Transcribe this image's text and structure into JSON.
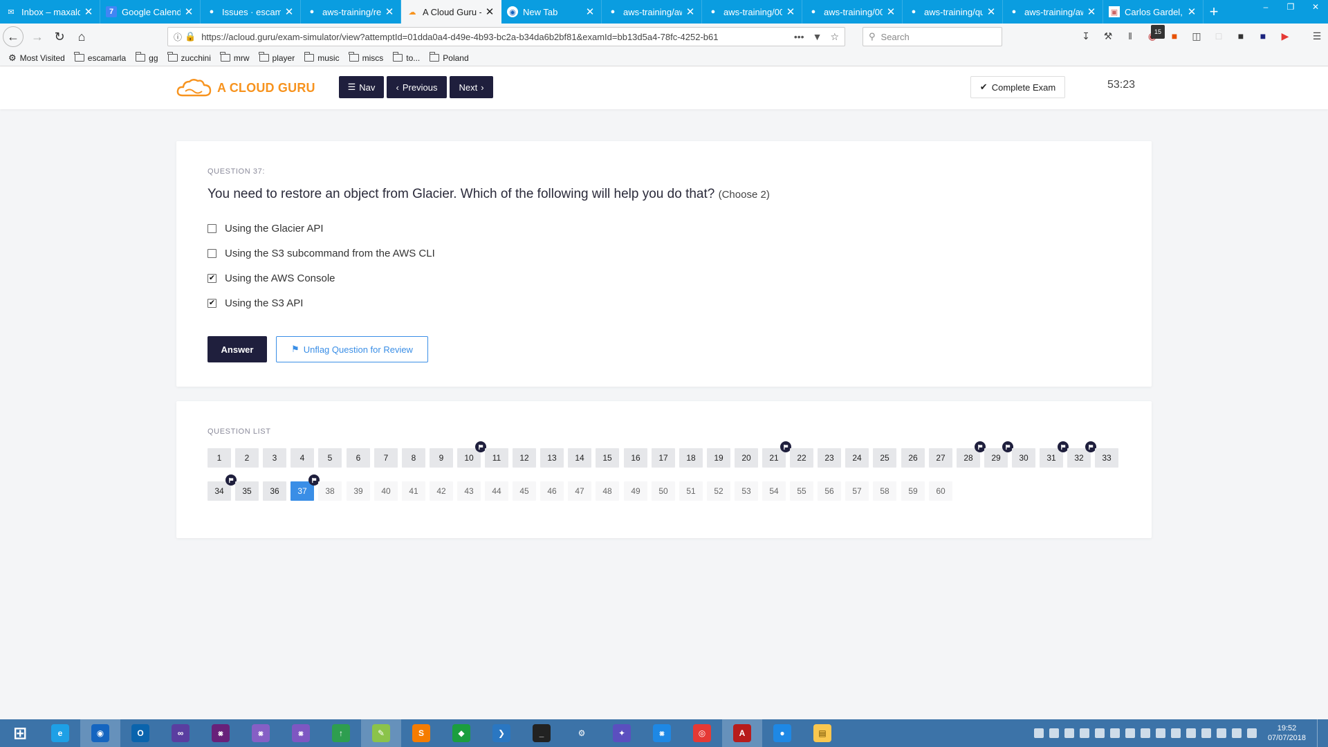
{
  "browser": {
    "tabs": [
      {
        "label": "Inbox – maxaldo",
        "icon": "mail-icon",
        "color": "#ffffff"
      },
      {
        "label": "Google Calendar",
        "icon": "calendar-icon",
        "color": "#ffffff"
      },
      {
        "label": "Issues · escamarla",
        "icon": "github-icon",
        "color": "#ffffff"
      },
      {
        "label": "aws-training/re",
        "icon": "github-icon",
        "color": "#ffffff"
      },
      {
        "label": "A Cloud Guru - ",
        "icon": "cloud-icon",
        "color": "#f7931e",
        "active": true
      },
      {
        "label": "New Tab",
        "icon": "firefox-icon",
        "color": "#ffffff"
      },
      {
        "label": "aws-training/aw",
        "icon": "github-icon",
        "color": "#ffffff"
      },
      {
        "label": "aws-training/00",
        "icon": "github-icon",
        "color": "#ffffff"
      },
      {
        "label": "aws-training/00",
        "icon": "github-icon",
        "color": "#ffffff"
      },
      {
        "label": "aws-training/qu",
        "icon": "github-icon",
        "color": "#ffffff"
      },
      {
        "label": "aws-training/aw",
        "icon": "github-icon",
        "color": "#ffffff"
      },
      {
        "label": "Carlos Gardel, Y",
        "icon": "page-icon",
        "color": "#ffffff"
      }
    ],
    "url": "https://acloud.guru/exam-simulator/view?attemptId=01dda0a4-d49e-4b93-bc2a-b34da6b2bf81&examId=bb13d5a4-78fc-4252-b61",
    "search_placeholder": "Search",
    "bookmarks": [
      {
        "label": "Most Visited",
        "type": "gear"
      },
      {
        "label": "escamarla",
        "type": "folder"
      },
      {
        "label": "gg",
        "type": "folder"
      },
      {
        "label": "zucchini",
        "type": "folder"
      },
      {
        "label": "mrw",
        "type": "folder"
      },
      {
        "label": "player",
        "type": "folder"
      },
      {
        "label": "music",
        "type": "folder"
      },
      {
        "label": "miscs",
        "type": "folder"
      },
      {
        "label": "to...",
        "type": "folder"
      },
      {
        "label": "Poland",
        "type": "folder"
      }
    ],
    "notification_badge": "15"
  },
  "header": {
    "logo_text": "A CLOUD GURU",
    "nav_label": "Nav",
    "previous_label": "Previous",
    "next_label": "Next",
    "complete_label": "Complete Exam",
    "timer": "53:23",
    "brand_color": "#f7931e",
    "dark_color": "#1f1f3d"
  },
  "question": {
    "eyebrow": "QUESTION 37:",
    "text": "You need to restore an object from Glacier. Which of the following will help you do that?",
    "choose": "(Choose 2)",
    "options": [
      {
        "label": "Using the Glacier API",
        "checked": false
      },
      {
        "label": "Using the S3 subcommand from the AWS CLI",
        "checked": false
      },
      {
        "label": "Using the AWS Console",
        "checked": true
      },
      {
        "label": "Using the S3 API",
        "checked": true
      }
    ],
    "answer_label": "Answer",
    "unflag_label": "Unflag Question for Review"
  },
  "question_list": {
    "title": "QUESTION LIST",
    "current": 37,
    "answered_through": 36,
    "flagged": [
      10,
      21,
      28,
      29,
      31,
      32,
      34,
      37
    ],
    "items": [
      "1",
      "2",
      "3",
      "4",
      "5",
      "6",
      "7",
      "8",
      "9",
      "10",
      "11",
      "12",
      "13",
      "14",
      "15",
      "16",
      "17",
      "18",
      "19",
      "20",
      "21",
      "22",
      "23",
      "24",
      "25",
      "26",
      "27",
      "28",
      "29",
      "30",
      "31",
      "32",
      "33",
      "34",
      "35",
      "36",
      "37",
      "38",
      "39",
      "40",
      "41",
      "42",
      "43",
      "44",
      "45",
      "46",
      "47",
      "48",
      "49",
      "50",
      "51",
      "52",
      "53",
      "54",
      "55",
      "56",
      "57",
      "58",
      "59",
      "60"
    ],
    "current_color": "#3a8ee6"
  },
  "taskbar": {
    "apps": [
      {
        "name": "start-icon",
        "color": "#3c73a8"
      },
      {
        "name": "internet-explorer-icon",
        "color": "#1ea0e6"
      },
      {
        "name": "firefox-icon",
        "color": "#1565c0",
        "active": true
      },
      {
        "name": "outlook-icon",
        "color": "#0a64ad"
      },
      {
        "name": "visual-studio-infinity-icon",
        "color": "#5a3ea0"
      },
      {
        "name": "visual-studio-icon",
        "color": "#68217a"
      },
      {
        "name": "visual-studio-icon",
        "color": "#865fc5"
      },
      {
        "name": "vs-code-purple-icon",
        "color": "#7e57c2"
      },
      {
        "name": "rocket-icon",
        "color": "#2e9e4f"
      },
      {
        "name": "notepad-icon",
        "color": "#8bc34a",
        "active": true
      },
      {
        "name": "sublime-icon",
        "color": "#f57c00"
      },
      {
        "name": "gitkraken-icon",
        "color": "#1b9e3e"
      },
      {
        "name": "powershell-icon",
        "color": "#2a77c2"
      },
      {
        "name": "terminal-icon",
        "color": "#222222"
      },
      {
        "name": "settings-icon",
        "color": "#3c73a8"
      },
      {
        "name": "network-sphere-icon",
        "color": "#5b4fbf"
      },
      {
        "name": "vs-code-icon",
        "color": "#1e88e5"
      },
      {
        "name": "chrome-icon",
        "color": "#e53935"
      },
      {
        "name": "acrobat-icon",
        "color": "#b71c1c",
        "active": true
      },
      {
        "name": "maps-icon",
        "color": "#1e88e5"
      },
      {
        "name": "file-explorer-icon",
        "color": "#f9c74f"
      }
    ],
    "time": "19:52",
    "date": "07/07/2018"
  }
}
